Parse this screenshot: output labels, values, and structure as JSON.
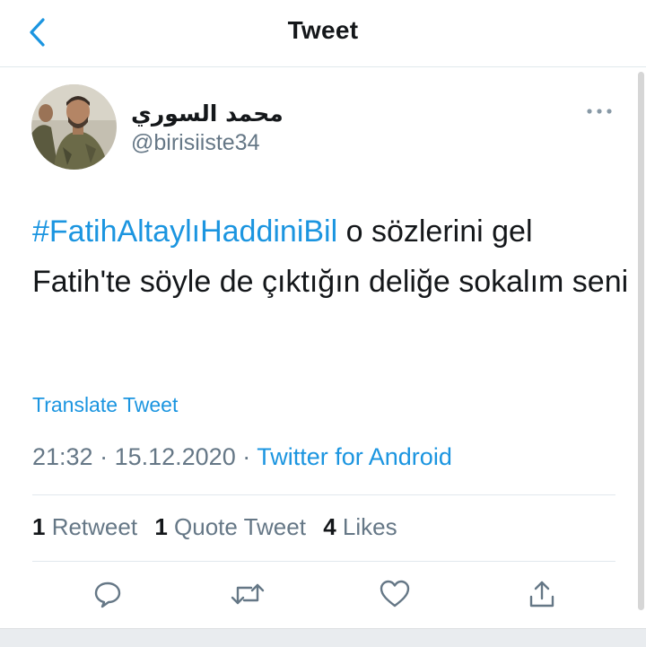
{
  "header": {
    "title": "Tweet",
    "back_icon": "chevron-left-icon"
  },
  "colors": {
    "accent": "#1b95e0",
    "text": "#14171a",
    "muted": "#657786",
    "divider": "#e1e8ed"
  },
  "tweet": {
    "author": {
      "display_name": "محمد السوري",
      "handle": "@birisiiste34"
    },
    "hashtag": "#FatihAltaylıHaddiniBil",
    "body": " o sözlerini gel Fatih'te söyle de çıktığın deliğe sokalım seni",
    "translate_label": "Translate Tweet",
    "time": "21:32",
    "separator": " · ",
    "date": "15.12.2020",
    "source": "Twitter for Android"
  },
  "stats": {
    "retweets_count": "1",
    "retweets_label": " Retweet",
    "quotes_count": "1",
    "quotes_label": " Quote Tweet",
    "likes_count": "4",
    "likes_label": " Likes"
  },
  "actions": [
    "reply-icon",
    "retweet-icon",
    "like-icon",
    "share-icon"
  ]
}
